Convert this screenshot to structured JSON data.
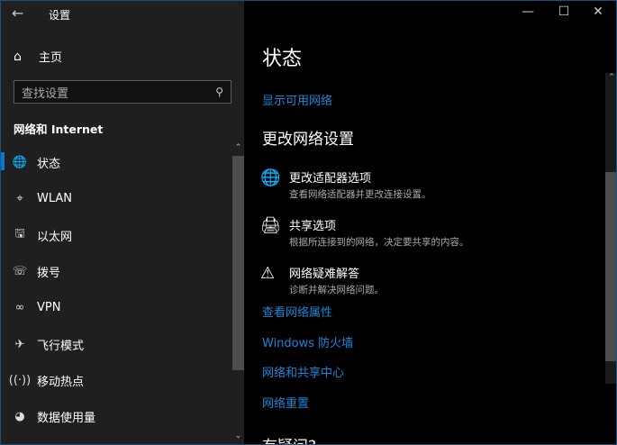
{
  "window": {
    "title": "设置",
    "minimize_icon": "minimize-icon",
    "maximize_icon": "maximize-icon",
    "close_icon": "close-icon"
  },
  "sidebar": {
    "home": "主页",
    "search_placeholder": "查找设置",
    "section": "网络和 Internet",
    "items": [
      {
        "label": "状态",
        "icon": "globe-icon"
      },
      {
        "label": "WLAN",
        "icon": "wifi-icon"
      },
      {
        "label": "以太网",
        "icon": "ethernet-icon"
      },
      {
        "label": "拨号",
        "icon": "dialup-icon"
      },
      {
        "label": "VPN",
        "icon": "vpn-icon"
      },
      {
        "label": "飞行模式",
        "icon": "airplane-icon"
      },
      {
        "label": "移动热点",
        "icon": "hotspot-icon"
      },
      {
        "label": "数据使用量",
        "icon": "data-usage-icon"
      }
    ],
    "selected": "状态"
  },
  "main": {
    "title": "状态",
    "show_networks": "显示可用网络",
    "change_heading": "更改网络设置",
    "options": [
      {
        "title": "更改适配器选项",
        "desc": "查看网络适配器并更改连接设置。"
      },
      {
        "title": "共享选项",
        "desc": "根据所连接到的网络，决定要共享的内容。"
      },
      {
        "title": "网络疑难解答",
        "desc": "诊断并解决网络问题。"
      }
    ],
    "links": [
      "查看网络属性",
      "Windows 防火墙",
      "网络和共享中心",
      "网络重置"
    ],
    "question_heading": "有疑问?"
  },
  "colors": {
    "accent": "#0078d7",
    "link": "#1a86d9",
    "sidebar_bg": "#1f1f1f",
    "main_bg": "#000000"
  }
}
